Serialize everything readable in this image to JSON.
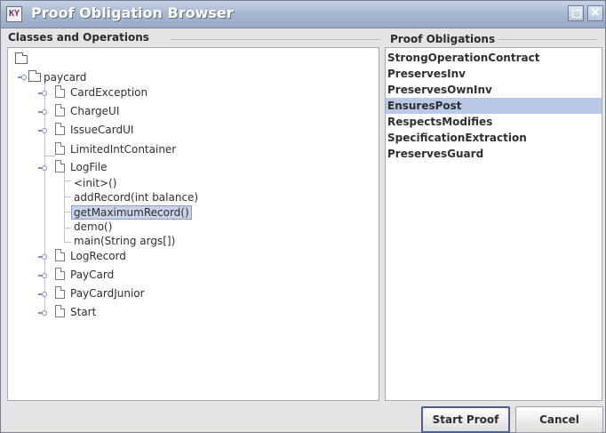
{
  "window": {
    "title": "Proof Obligation Browser",
    "app_icon_text": "KY"
  },
  "left_panel": {
    "label": "Classes and Operations",
    "tree": {
      "root_label": "",
      "package": "paycard",
      "classes": [
        "CardException",
        "ChargeUI",
        "IssueCardUI",
        "LimitedIntContainer",
        "LogFile",
        "LogRecord",
        "PayCard",
        "PayCardJunior",
        "Start"
      ],
      "logfile_methods": [
        "<init>()",
        "addRecord(int balance)",
        "getMaximumRecord()",
        "demo()",
        "main(String args[])"
      ],
      "selected_method": "getMaximumRecord()"
    }
  },
  "right_panel": {
    "label": "Proof Obligations",
    "items": [
      "StrongOperationContract",
      "PreservesInv",
      "PreservesOwnInv",
      "EnsuresPost",
      "RespectsModifies",
      "SpecificationExtraction",
      "PreservesGuard"
    ],
    "selected": "EnsuresPost"
  },
  "buttons": {
    "start": "Start Proof",
    "cancel": "Cancel"
  }
}
